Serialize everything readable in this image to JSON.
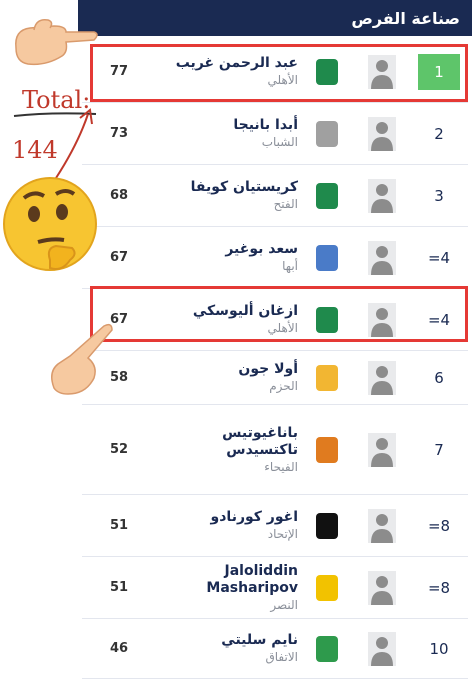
{
  "header": {
    "title": "صناعة الفرص"
  },
  "rows": [
    {
      "rank": "1",
      "name": "عبد الرحمن غريب",
      "club": "الأهلي",
      "value": "77"
    },
    {
      "rank": "2",
      "name": "أبدا بانيجا",
      "club": "الشباب",
      "value": "73"
    },
    {
      "rank": "3",
      "name": "كريستيان كويفا",
      "club": "الفتح",
      "value": "68"
    },
    {
      "rank": "=4",
      "name": "سعد بوغير",
      "club": "أبها",
      "value": "67"
    },
    {
      "rank": "=4",
      "name": "ازغان أليوسكي",
      "club": "الأهلي",
      "value": "67"
    },
    {
      "rank": "6",
      "name": "أولا جون",
      "club": "الحزم",
      "value": "58"
    },
    {
      "rank": "7",
      "name": "باناغيوتيس تاكتسيدس",
      "club": "الفيحاء",
      "value": "52"
    },
    {
      "rank": "=8",
      "name": "اغور كورنادو",
      "club": "الإتحاد",
      "value": "51"
    },
    {
      "rank": "=8",
      "name": "Jaloliddin Masharipov",
      "club": "النصر",
      "value": "51"
    },
    {
      "rank": "10",
      "name": "نايم سليتي",
      "club": "الاتفاق",
      "value": "46"
    }
  ],
  "annotation": {
    "total_label": "Total:",
    "total_value": "144"
  },
  "colors": {
    "header_bg": "#1a2a52",
    "highlight": "#e53935",
    "rank_first_bg": "#5ec56a",
    "annotation": "#c0392b"
  },
  "club_colors": [
    "#1f8a4c",
    "#a0a0a0",
    "#1f8a4c",
    "#4a7bc8",
    "#1f8a4c",
    "#f2b632",
    "#e07b1f",
    "#111111",
    "#f2c200",
    "#2e9a4c"
  ],
  "icons": [
    "pointing-hand-icon",
    "thinking-face-icon",
    "person-placeholder-icon",
    "club-crest-icon"
  ]
}
